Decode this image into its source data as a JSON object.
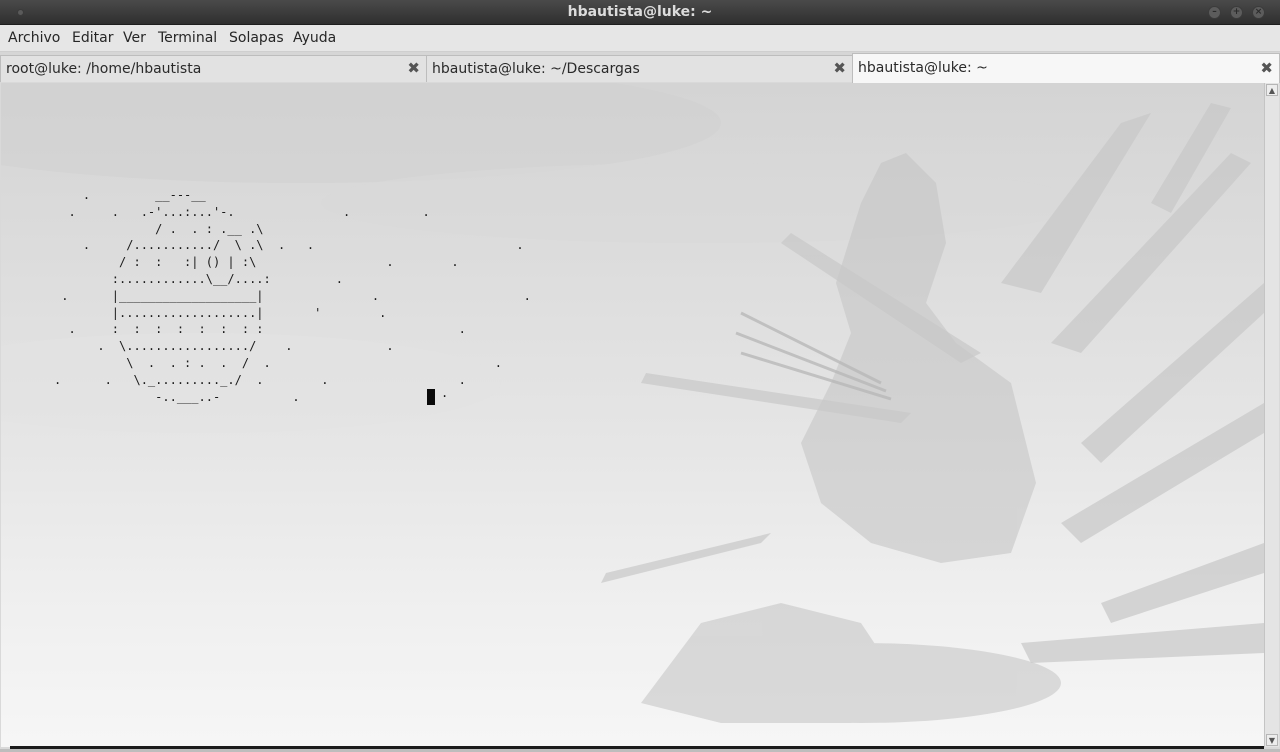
{
  "window": {
    "title": "hbautista@luke: ~"
  },
  "menubar": {
    "items": [
      "Archivo",
      "Editar",
      "Ver",
      "Terminal",
      "Solapas",
      "Ayuda"
    ]
  },
  "tabs": [
    {
      "label": "root@luke: /home/hbautista",
      "active": false
    },
    {
      "label": "hbautista@luke: ~/Descargas",
      "active": false
    },
    {
      "label": "hbautista@luke: ~",
      "active": true
    }
  ],
  "terminal": {
    "ascii_art": "    .         __---__\n  .     .   .-'...:...'-.               .          .\n              / .  . : .__ .\\\n    .     /.........../  \\ .\\  .   .                            .\n         / :  :   :| () | :\\                  .        .\n        :............\\__/....:         .\n .      |___________________|               .                    .\n        |...................|       '        .\n  .     :  :  :  :  :  :  : :                           .\n      .  \\................./    .             .\n          \\  .  . : .  .  /  .                               .\n.      .   \\._........._./  .        .                  .\n              -..___..-          .",
    "cursor_trail": " ."
  },
  "colors": {
    "titlebar": "#3a3a3a",
    "menubar": "#e6e6e6",
    "active_tab": "#f7f7f7",
    "terminal_bg": "#e2e2e2",
    "text": "#1b1b1b"
  },
  "icons": {
    "window_menu": "dot-icon",
    "minimize": "minimize-icon",
    "maximize": "maximize-icon",
    "close": "close-icon",
    "tab_close": "close-x-icon"
  }
}
